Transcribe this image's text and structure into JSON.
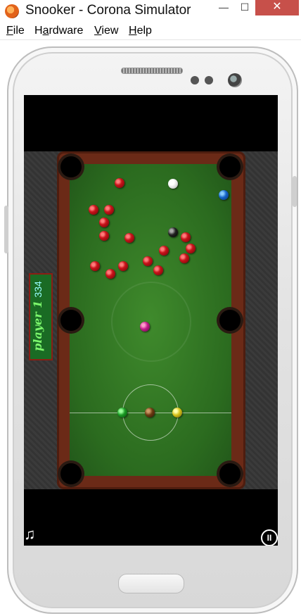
{
  "window": {
    "title": "Snooker - Corona Simulator",
    "controls": {
      "minimize": "—",
      "maximize": "☐",
      "close": "✕"
    }
  },
  "menu": {
    "items": [
      {
        "label": "File",
        "mnemonic_index": 0
      },
      {
        "label": "Hardware",
        "mnemonic_index": 1
      },
      {
        "label": "View",
        "mnemonic_index": 0
      },
      {
        "label": "Help",
        "mnemonic_index": 0
      }
    ]
  },
  "game": {
    "player_label": "player 1",
    "score": "334",
    "icons": {
      "music": "music-note-icon",
      "pause": "pause-icon"
    }
  },
  "colors": {
    "felt": "#2b6b1f",
    "rail": "#6b2a17",
    "score_bg": "#1a6b24",
    "score_text": "#7cf76c",
    "title_close": "#c7504a"
  }
}
